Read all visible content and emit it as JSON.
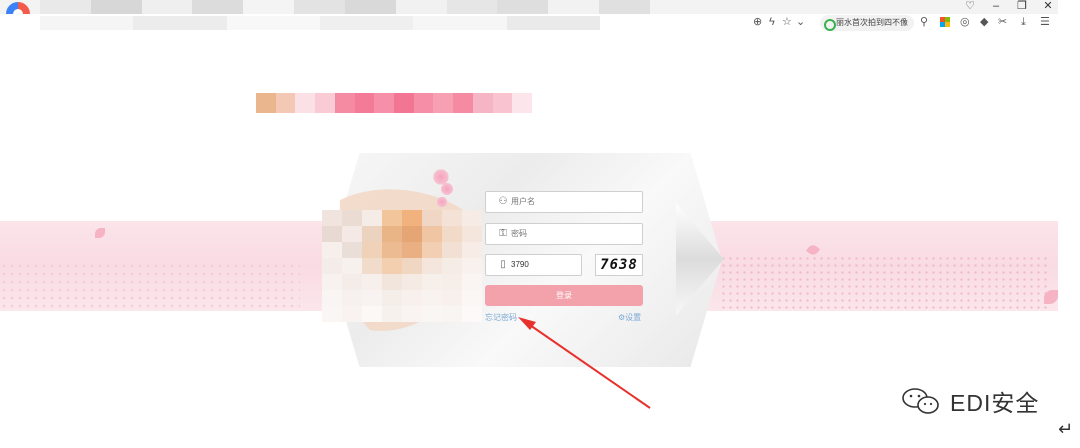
{
  "browser": {
    "toolbar_icons": [
      "zoom-icon",
      "lightning-icon",
      "star-icon",
      "chevron-down-icon"
    ],
    "news_pill": "丽水首次拍到四不像",
    "extension_icons": [
      "microsoft-apps-icon",
      "circle-icon",
      "diamond-icon",
      "scissors-icon",
      "download-icon",
      "menu-icon"
    ],
    "window_controls": [
      "shirt-icon",
      "minimize-icon",
      "restore-icon",
      "close-icon"
    ]
  },
  "login": {
    "username_placeholder": "用户名",
    "password_placeholder": "密码",
    "captcha_value": "3790",
    "captcha_image_text": "7638",
    "login_button": "登录",
    "forgot_password": "忘记密码",
    "settings_link": "设置"
  },
  "watermark": {
    "text": "EDI安全",
    "icon": "wechat-icon"
  },
  "colors": {
    "login_button": "#f3a1ab",
    "band": "#f9dbe3",
    "arrow": "#e8312c",
    "link": "#7aa9d6"
  }
}
